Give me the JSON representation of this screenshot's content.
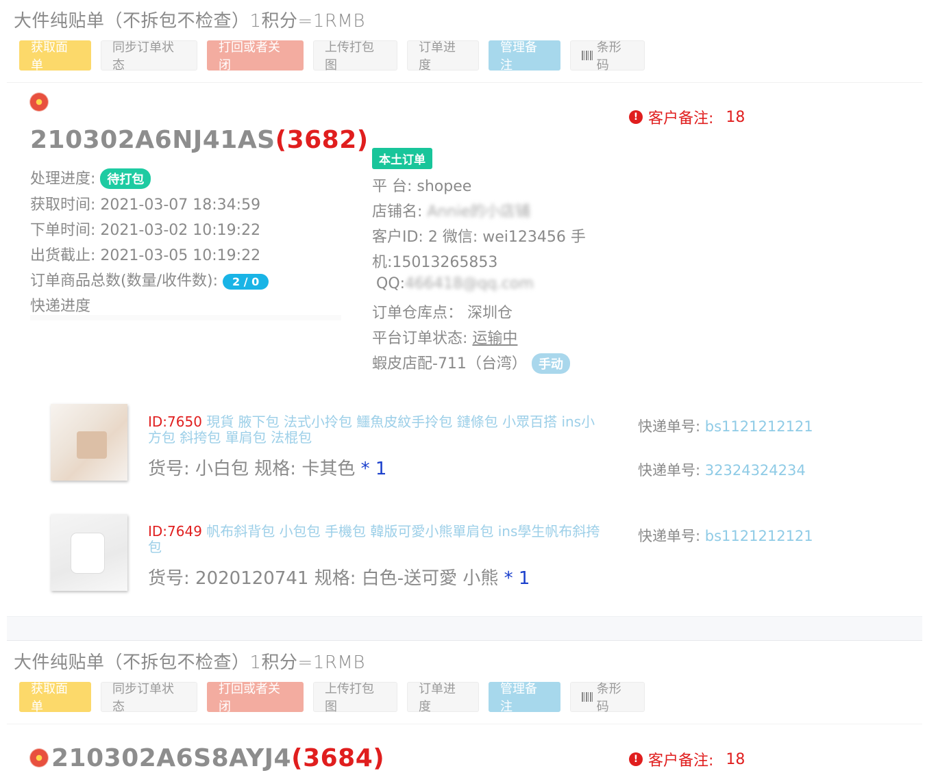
{
  "orders": [
    {
      "section_title": "大件纯贴单（不拆包不检查）1积分=1RMB",
      "toolbar": {
        "get_label": "获取面单",
        "sync_label": "同步订单状态",
        "return_label": "打回或者关闭",
        "upload_label": "上传打包图",
        "progress_label": "订单进度",
        "remark_label": "管理备注",
        "barcode_label": "条形码"
      },
      "order_no": "210302A6NJ41AS",
      "order_count": "(3682)",
      "customer_remark_label": "客户备注:",
      "customer_remark_value": "18",
      "status_label": "处理进度:",
      "status_value": "待打包",
      "fetch_time_label": "获取时间:",
      "fetch_time": "2021-03-07 18:34:59",
      "order_time_label": "下单时间:",
      "order_time": "2021-03-02 10:19:22",
      "ship_deadline_label": "出货截止:",
      "ship_deadline": "2021-03-05 10:19:22",
      "item_total_label": "订单商品总数(数量/收件数):",
      "item_total": "2 / 0",
      "express_progress_label": "快递进度",
      "local_tag": "本土订单",
      "platform_label": "平 台:",
      "platform": "shopee",
      "shop_label": "店铺名:",
      "shop_name": "Annie的小店铺",
      "customer_label": "客户ID: 2  微信: wei123456  手",
      "customer_phone": "机:15013265853",
      "qq_label": "QQ:",
      "qq_value": "466418@qq.com",
      "warehouse_label": "订单仓库点：",
      "warehouse": "深圳仓",
      "platform_status_label": "平台订单状态:",
      "platform_status": "运输中",
      "delivery": "蝦皮店配-711（台湾）",
      "delivery_mode": "手动",
      "products": [
        {
          "id": "ID:7650",
          "title": "現貨 腋下包 法式小拎包 鱷魚皮紋手拎包 鏈條包 小眾百搭 ins小方包 斜挎包 單肩包 法棍包",
          "spec": "货号:  小白包  规格: 卡其色",
          "qty": "* 1",
          "express_label": "快递单号:",
          "express_nos": [
            "bs1121212121",
            "32324324234"
          ]
        },
        {
          "id": "ID:7649",
          "title": "帆布斜背包 小包包 手機包 韓版可愛小熊單肩包 ins學生帆布斜挎包",
          "spec": "货号:  2020120741  规格: 白色-送可愛 小熊",
          "qty": "* 1",
          "express_label": "快递单号:",
          "express_nos": [
            "bs1121212121"
          ]
        }
      ]
    },
    {
      "section_title": "大件纯贴单（不拆包不检查）1积分=1RMB",
      "toolbar": {
        "get_label": "获取面单",
        "sync_label": "同步订单状态",
        "return_label": "打回或者关闭",
        "upload_label": "上传打包图",
        "progress_label": "订单进度",
        "remark_label": "管理备注",
        "barcode_label": "条形码"
      },
      "order_no": "210302A6S8AYJ4",
      "order_count": "(3684)",
      "customer_remark_label": "客户备注:",
      "customer_remark_value": "18"
    }
  ],
  "colors": {
    "accent_yellow": "#fcd96a",
    "accent_red": "#f3aca0",
    "accent_blue": "#a7d8ec",
    "alert_red": "#e01e1e",
    "status_green": "#1ecba2",
    "link_blue": "#9ccfe8"
  }
}
